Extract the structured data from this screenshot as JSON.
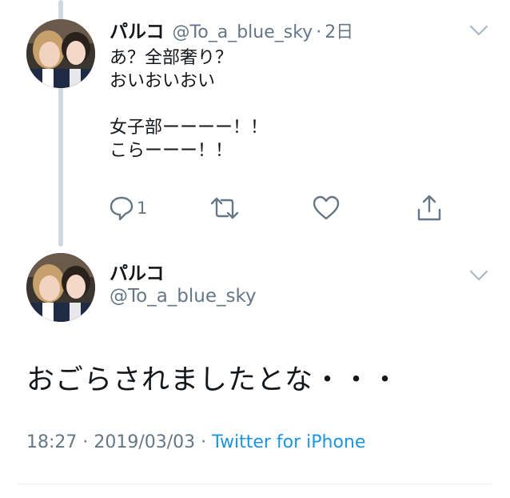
{
  "tweet1": {
    "display_name": "パルコ",
    "handle": "@To_a_blue_sky",
    "separator": "·",
    "time": "2日",
    "lines": [
      "あ？全部奢り？",
      "おいおいおい",
      "",
      "女子部ーーーー！！",
      "こらーーー！！"
    ],
    "actions": {
      "reply_icon": "reply-icon",
      "reply_count": "1",
      "retweet_icon": "retweet-icon",
      "like_icon": "heart-icon",
      "share_icon": "share-icon"
    }
  },
  "tweet2": {
    "display_name": "パルコ",
    "handle": "@To_a_blue_sky",
    "text": "おごらされましたとな・・・",
    "timestamp": "18:27 · 2019/03/03 · ",
    "source": "Twitter for iPhone"
  },
  "colors": {
    "text": "#14171a",
    "secondary": "#657786",
    "link": "#1b95e0",
    "thread_line": "#cfd9de"
  }
}
